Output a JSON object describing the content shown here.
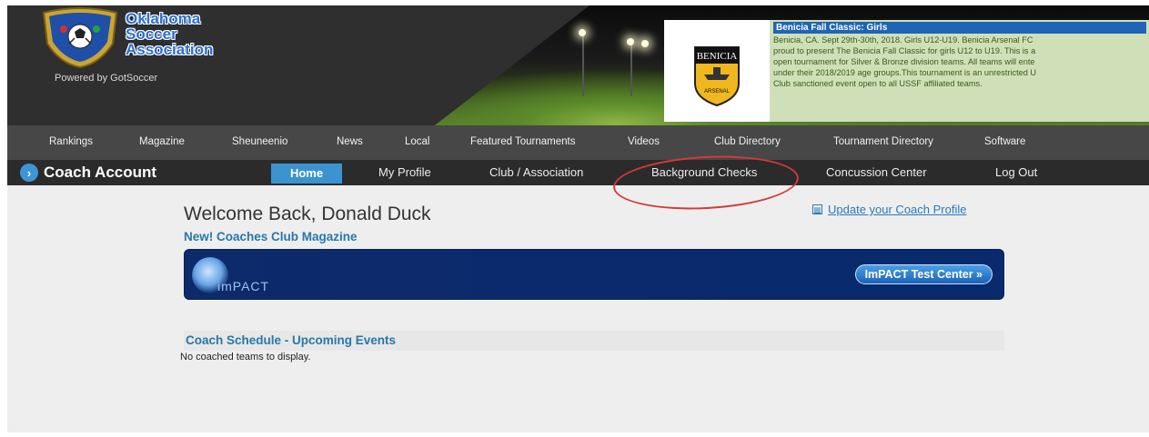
{
  "brand": {
    "name_lines": [
      "Oklahoma",
      "Soccer",
      "Association"
    ],
    "powered_by": "Powered by GotSoccer"
  },
  "news": {
    "title": "Benicia Fall Classic: Girls",
    "body_lines": [
      "Benicia, CA. Sept 29th-30th, 2018. Girls U12-U19. Benicia Arsenal FC",
      "proud to present The Benicia Fall Classic for girls U12 to U19. This is a",
      "open tournament for Silver & Bronze division teams. All teams will ente",
      "under their 2018/2019 age groups.This tournament is an unrestricted U",
      "Club sanctioned event open to all USSF affiliated teams."
    ],
    "logo_text": "BENICIA",
    "logo_subtext": "ARSENAL"
  },
  "main_nav": [
    {
      "label": "Rankings",
      "slug": "rankings"
    },
    {
      "label": "Magazine",
      "slug": "magazine"
    },
    {
      "label": "Sheuneenio",
      "slug": "sheuneenio"
    },
    {
      "label": "News",
      "slug": "news"
    },
    {
      "label": "Local",
      "slug": "local"
    },
    {
      "label": "Featured Tournaments",
      "slug": "featured-tournaments"
    },
    {
      "label": "Videos",
      "slug": "videos"
    },
    {
      "label": "Club Directory",
      "slug": "club-directory"
    },
    {
      "label": "Tournament Directory",
      "slug": "tournament-directory"
    },
    {
      "label": "Software",
      "slug": "software"
    }
  ],
  "sub_nav": {
    "section_label": "Coach Account",
    "tabs": [
      {
        "label": "Home",
        "active": true
      },
      {
        "label": "My Profile",
        "active": false
      },
      {
        "label": "Club / Association",
        "active": false
      },
      {
        "label": "Background Checks",
        "active": false
      },
      {
        "label": "Concussion Center",
        "active": false
      },
      {
        "label": "Log Out",
        "active": false
      }
    ]
  },
  "content": {
    "welcome": "Welcome Back, Donald Duck",
    "update_profile_link": "Update your Coach Profile",
    "new_magazine": "New! Coaches Club Magazine",
    "impact_logo_text": "imPACT",
    "impact_button": "ImPACT Test Center »",
    "schedule_title": "Coach Schedule - Upcoming Events",
    "no_teams": "No coached teams to display."
  },
  "colors": {
    "accent_blue": "#3b94d0",
    "link_blue": "#2778a8",
    "annotation_red": "#d53a3a",
    "nav_bg": "#474747",
    "subnav_bg": "#2b2b2b"
  }
}
